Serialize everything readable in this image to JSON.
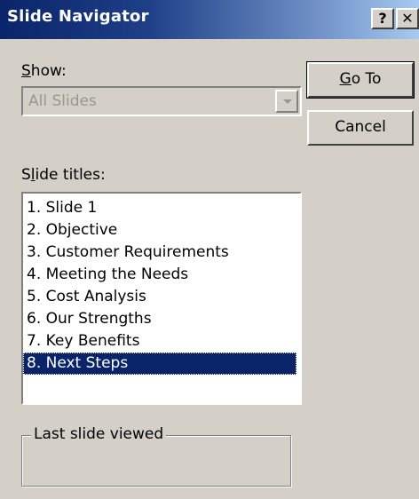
{
  "window": {
    "title": "Slide Navigator",
    "help_button": "?",
    "close_button": "✕"
  },
  "show": {
    "label_accel": "S",
    "label_rest": "how:",
    "selected_value": "All Slides"
  },
  "slide_titles": {
    "label_pre": "S",
    "label_accel": "l",
    "label_rest": "ide titles:",
    "items": [
      "1. Slide 1",
      "2. Objective",
      "3. Customer Requirements",
      "4. Meeting the Needs",
      "5. Cost Analysis",
      "6. Our Strengths",
      "7. Key Benefits",
      "8. Next Steps"
    ],
    "selected_index": 7
  },
  "last_slide": {
    "legend": "Last slide viewed",
    "value": ""
  },
  "buttons": {
    "goto_accel": "G",
    "goto_rest": "o To",
    "cancel": "Cancel"
  }
}
